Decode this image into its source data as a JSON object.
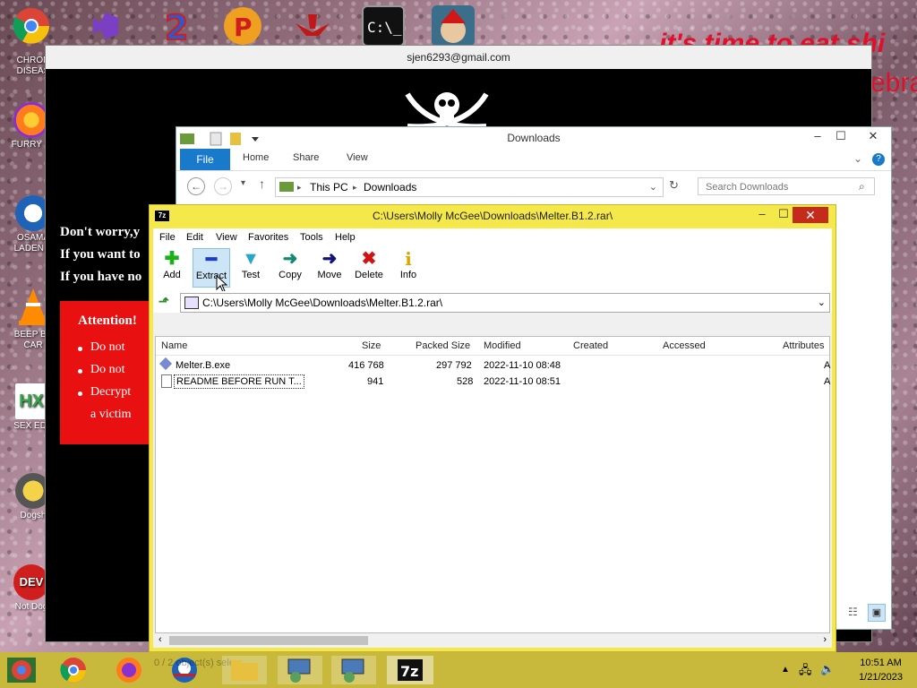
{
  "desktop": {
    "icons": [
      {
        "label": "CHRON\nDISEAS",
        "color": "#2f9a3f"
      },
      {
        "label": "FURRY G",
        "color": "#ff7b1c"
      },
      {
        "label": "OSAMA\nLADEN B",
        "color": "#1e63b8"
      },
      {
        "label": "BEEP BE\nCAR",
        "color": "#ff8c00"
      },
      {
        "label": "SEX EDI",
        "color": "#3aa34a"
      },
      {
        "label": "Dogsh",
        "color": "#c8a01a"
      },
      {
        "label": "Not Dog",
        "color": "#d01d1d"
      }
    ],
    "bg_text_1": "it's time to eat shi",
    "bg_text_2": "ebra"
  },
  "ransom": {
    "title": "sjen6293@gmail.com",
    "line1": "Don't worry,y",
    "line2": "If you want to",
    "line3": "If you have no",
    "box_title": "Attention!",
    "items": [
      "Do not",
      "Do not",
      "Decrypt"
    ],
    "item_extra": "a victim"
  },
  "explorer": {
    "title": "Downloads",
    "tabs": {
      "file": "File",
      "home": "Home",
      "share": "Share",
      "view": "View"
    },
    "path": {
      "pc": "This PC",
      "folder": "Downloads"
    },
    "search_placeholder": "Search Downloads"
  },
  "sevenzip": {
    "title": "C:\\Users\\Molly McGee\\Downloads\\Melter.B1.2.rar\\",
    "logo": "7z",
    "menu": [
      "File",
      "Edit",
      "View",
      "Favorites",
      "Tools",
      "Help"
    ],
    "toolbar": [
      {
        "label": "Add",
        "glyph": "✚",
        "color": "#19b019"
      },
      {
        "label": "Extract",
        "glyph": "━",
        "color": "#1a3bd0"
      },
      {
        "label": "Test",
        "glyph": "▼",
        "color": "#27a8c8"
      },
      {
        "label": "Copy",
        "glyph": "➜",
        "color": "#138a70"
      },
      {
        "label": "Move",
        "glyph": "➜",
        "color": "#12127a"
      },
      {
        "label": "Delete",
        "glyph": "✖",
        "color": "#d01414"
      },
      {
        "label": "Info",
        "glyph": "i",
        "color": "#d8a800"
      }
    ],
    "address": "C:\\Users\\Molly McGee\\Downloads\\Melter.B1.2.rar\\",
    "columns": [
      "Name",
      "Size",
      "Packed Size",
      "Modified",
      "Created",
      "Accessed",
      "Attributes"
    ],
    "rows": [
      {
        "name": "Melter.B.exe",
        "size": "416 768",
        "packed": "297 792",
        "modified": "2022-11-10 08:48",
        "attr": "A"
      },
      {
        "name": "README BEFORE RUN T...",
        "size": "941",
        "packed": "528",
        "modified": "2022-11-10 08:51",
        "attr": "A"
      }
    ]
  },
  "taskbar": {
    "time": "10:51 AM",
    "date": "1/21/2023",
    "ghost": "0 / 2 object(s) selec"
  }
}
